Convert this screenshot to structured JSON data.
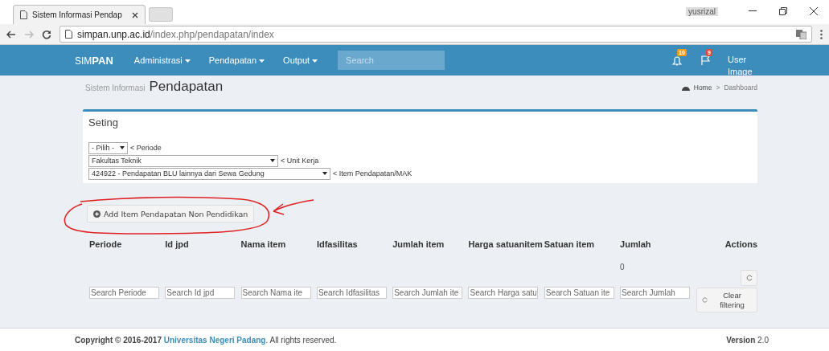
{
  "browser": {
    "tab_title": "Sistem Informasi Pendap",
    "url_host": "simpan.unp.ac.id",
    "url_path": "/index.php/pendapatan/index",
    "profile": "yusrizal"
  },
  "navbar": {
    "brand_light": "SIM",
    "brand_bold": "PAN",
    "menus": [
      "Administrasi",
      "Pendapatan",
      "Output"
    ],
    "search": {
      "placeholder": "Search"
    },
    "notifications": "10",
    "flags": "9",
    "user": "User Image"
  },
  "header": {
    "subtitle": "Sistem Informasi",
    "title": "Pendapatan",
    "breadcrumb": [
      "Home",
      "Dashboard"
    ],
    "breadcrumb_separator": ">"
  },
  "settings": {
    "title": "Seting",
    "fields": [
      {
        "selected_option": "- Pilih -",
        "hint": "< Periode"
      },
      {
        "selected_option": "Fakultas Teknik",
        "hint": "< Unit Kerja"
      },
      {
        "selected_option": "424922 - Pendapatan BLU lainnya dari Sewa Gedung",
        "hint": "< Item Pendapatan/MAK"
      }
    ]
  },
  "add_button": "Add Item Pendapatan Non Pendidikan",
  "table": {
    "columns": [
      "Periode",
      "Id jpd",
      "Nama item",
      "Idfasilitas",
      "Jumlah item",
      "Harga satuanitem",
      "Satuan item",
      "Jumlah",
      "Actions"
    ],
    "jumlah_total": "0",
    "filters": [
      {
        "placeholder": "Search Periode"
      },
      {
        "placeholder": "Search Id jpd"
      },
      {
        "placeholder": "Search Nama ite"
      },
      {
        "placeholder": "Search Idfasilitas"
      },
      {
        "placeholder": "Search Jumlah ite"
      },
      {
        "placeholder": "Search Harga satu"
      },
      {
        "placeholder": "Search Satuan ite"
      },
      {
        "placeholder": "Search Jumlah"
      }
    ],
    "clear_button": "Clear filtering"
  },
  "footer": {
    "copyright": "**Copyright © 2016-2017** ",
    "link": "Universitas Negeri Padang",
    "suffix": ". All rights reserved.",
    "version": "**Version** 2.0"
  }
}
